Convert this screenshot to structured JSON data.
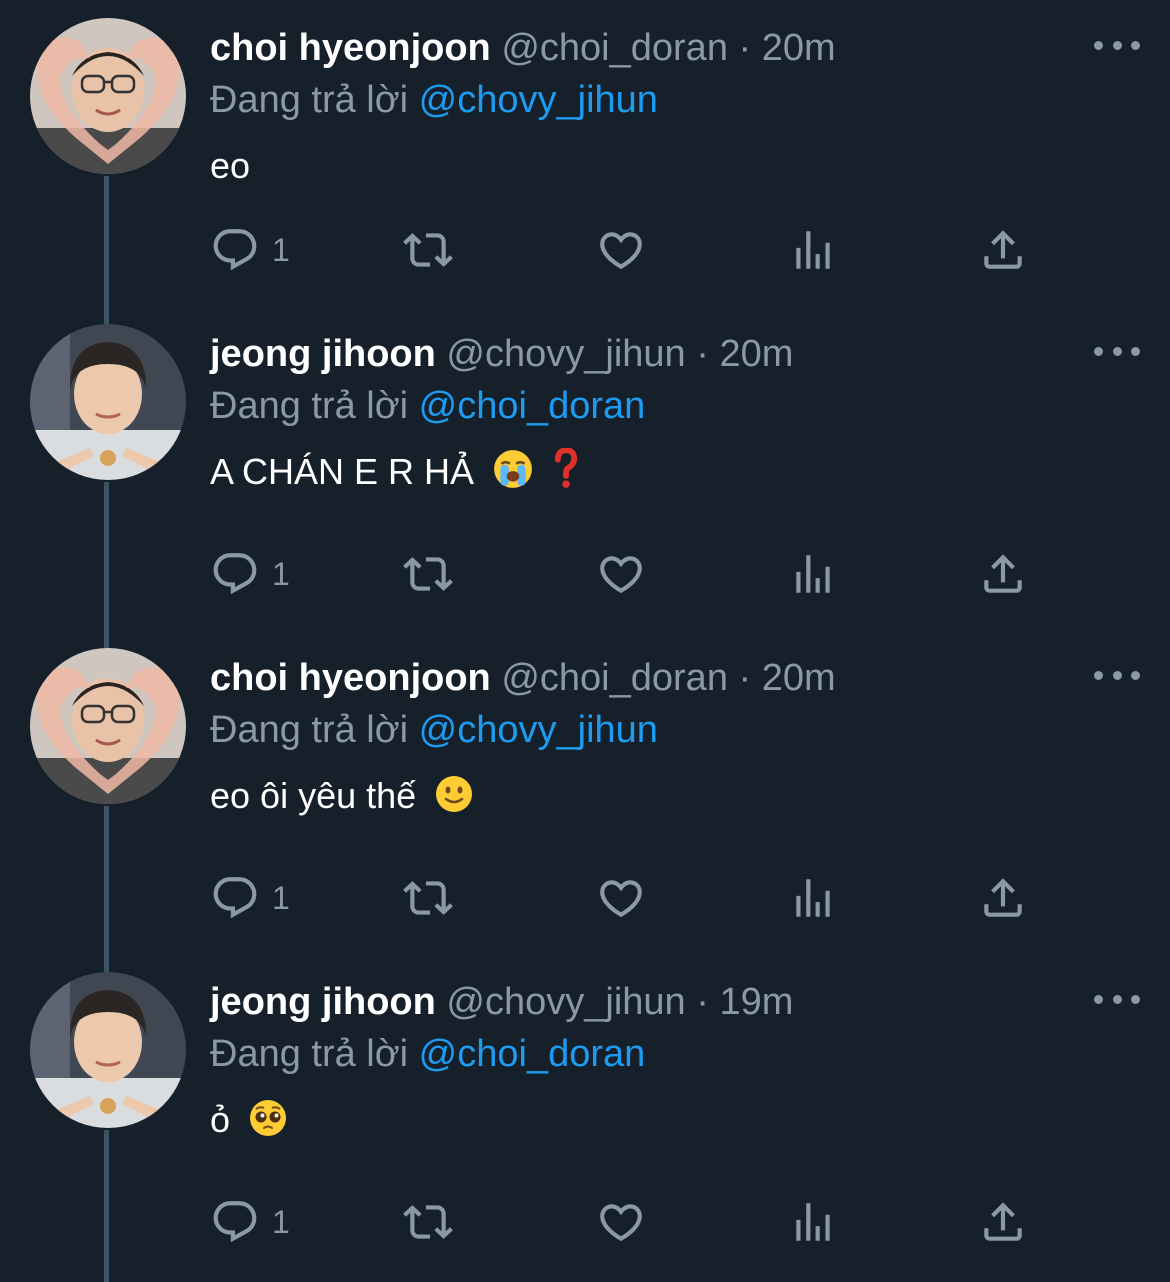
{
  "colors": {
    "background": "#15202b",
    "text_primary": "#ffffff",
    "text_secondary": "#8b98a5",
    "mention": "#1d9bf0",
    "thread_line": "#3d5466"
  },
  "tweets": [
    {
      "author_name": "choi hyeonjoon",
      "handle": "@choi_doran",
      "separator": "·",
      "time": "20m",
      "reply_prefix": "Đang trả lời",
      "reply_to": "@chovy_jihun",
      "text": "eo",
      "emojis": [],
      "reply_count": "1",
      "avatar": "avatar-heart-hands"
    },
    {
      "author_name": "jeong jihoon",
      "handle": "@chovy_jihun",
      "separator": "·",
      "time": "20m",
      "reply_prefix": "Đang trả lời",
      "reply_to": "@choi_doran",
      "text": "A CHÁN E R HẢ",
      "emojis": [
        "loudly-crying-face",
        "red-question-mark"
      ],
      "reply_count": "1",
      "avatar": "avatar-pointing-hands"
    },
    {
      "author_name": "choi hyeonjoon",
      "handle": "@choi_doran",
      "separator": "·",
      "time": "20m",
      "reply_prefix": "Đang trả lời",
      "reply_to": "@chovy_jihun",
      "text": "eo ôi yêu thế",
      "emojis": [
        "slightly-smiling-face"
      ],
      "reply_count": "1",
      "avatar": "avatar-heart-hands"
    },
    {
      "author_name": "jeong jihoon",
      "handle": "@chovy_jihun",
      "separator": "·",
      "time": "19m",
      "reply_prefix": "Đang trả lời",
      "reply_to": "@choi_doran",
      "text": "ỏ",
      "emojis": [
        "pleading-face"
      ],
      "reply_count": "1",
      "avatar": "avatar-pointing-hands"
    }
  ]
}
